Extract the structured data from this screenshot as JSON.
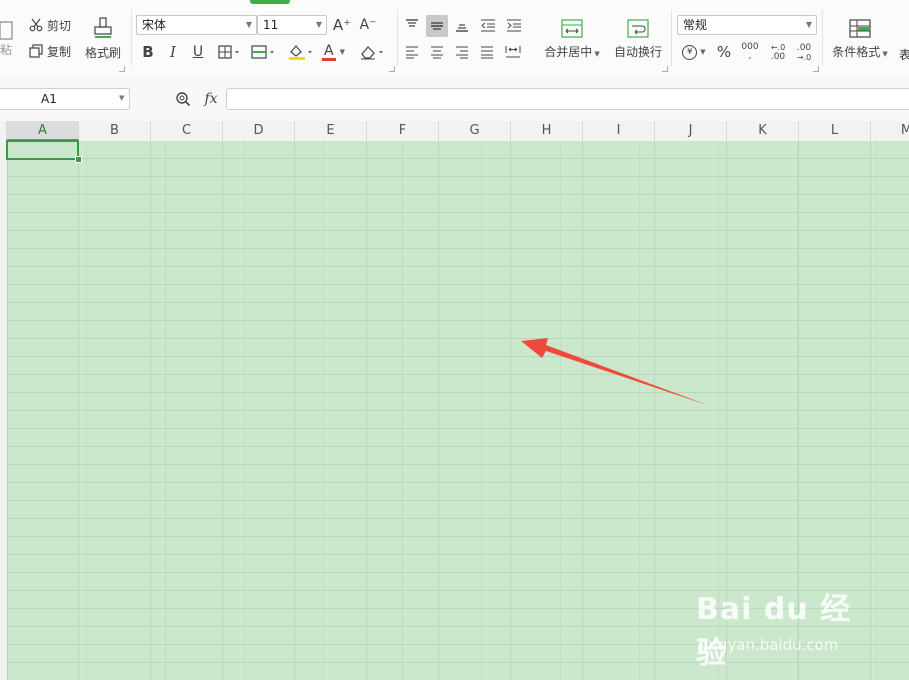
{
  "ribbon": {
    "paste_label": "粘",
    "cut_label": "剪切",
    "copy_label": "复制",
    "format_painter_label": "格式刷",
    "font_name": "宋体",
    "font_size": "11",
    "increase_font_label": "A⁺",
    "decrease_font_label": "A⁻",
    "bold_label": "B",
    "italic_label": "I",
    "underline_label": "U",
    "font_color_label": "A",
    "merge_center_label": "合并居中",
    "wrap_text_label": "自动换行",
    "number_format": "常规",
    "currency_label": "¥",
    "percent_label": "%",
    "thousands_label": "000",
    "inc_decimal_label": ".00",
    "dec_decimal_label": ".00",
    "conditional_format_label": "条件格式",
    "table_style_label": "表",
    "colors": {
      "accent_green": "#3fae4a",
      "font_red": "#e53935",
      "fill_yellow": "#f5d90a"
    }
  },
  "formula_bar": {
    "cell_reference": "A1",
    "zoom_icon": "magnifier-icon",
    "fx_label": "fx",
    "formula_value": ""
  },
  "grid": {
    "columns": [
      "A",
      "B",
      "C",
      "D",
      "E",
      "F",
      "G",
      "H",
      "I",
      "J",
      "K",
      "L",
      "M"
    ],
    "selected_column": "A",
    "selected_cell": "A1",
    "background": "#cbe8cd"
  },
  "annotation": {
    "arrow_color": "#f04a3f"
  },
  "watermark": {
    "logo": "Bai du 经验",
    "url": "jingyan.baidu.com"
  }
}
